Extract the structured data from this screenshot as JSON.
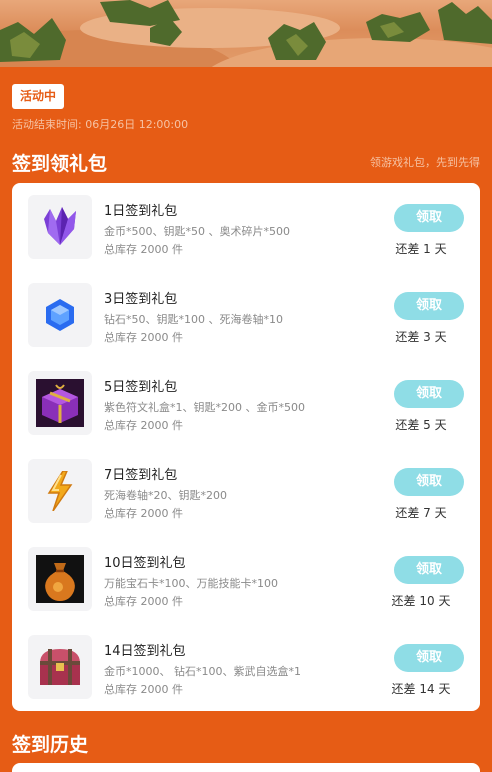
{
  "status_badge": "活动中",
  "end_time": "活动结束时间: 06月26日 12:00:00",
  "sign_section": {
    "title": "签到领礼包",
    "hint": "领游戏礼包，先到先得"
  },
  "packages": [
    {
      "title": "1日签到礼包",
      "items": "金币*500、钥匙*50 、奥术碎片*500",
      "stock": "总库存 2000 件",
      "button": "领取",
      "remaining": "还差 1 天",
      "icon": "purple-crystal-icon"
    },
    {
      "title": "3日签到礼包",
      "items": "钻石*50、钥匙*100 、死海卷轴*10",
      "stock": "总库存 2000 件",
      "button": "领取",
      "remaining": "还差 3 天",
      "icon": "blue-diamond-icon"
    },
    {
      "title": "5日签到礼包",
      "items": "紫色符文礼盒*1、钥匙*200 、金币*500",
      "stock": "总库存 2000 件",
      "button": "领取",
      "remaining": "还差 5 天",
      "icon": "purple-gift-box-icon"
    },
    {
      "title": "7日签到礼包",
      "items": "死海卷轴*20、钥匙*200",
      "stock": "总库存 2000 件",
      "button": "领取",
      "remaining": "还差 7 天",
      "icon": "lightning-icon"
    },
    {
      "title": "10日签到礼包",
      "items": "万能宝石卡*100、万能技能卡*100",
      "stock": "总库存 2000 件",
      "button": "领取",
      "remaining": "还差 10 天",
      "icon": "coin-bag-icon"
    },
    {
      "title": "14日签到礼包",
      "items": "金币*1000、 钻石*100、紫武自选盒*1",
      "stock": "总库存 2000 件",
      "button": "领取",
      "remaining": "还差 14 天",
      "icon": "treasure-chest-icon"
    }
  ],
  "history_section": {
    "title": "签到历史"
  },
  "colors": {
    "background": "#e65c15",
    "claim_button": "#8fdde6",
    "card": "#ffffff"
  }
}
